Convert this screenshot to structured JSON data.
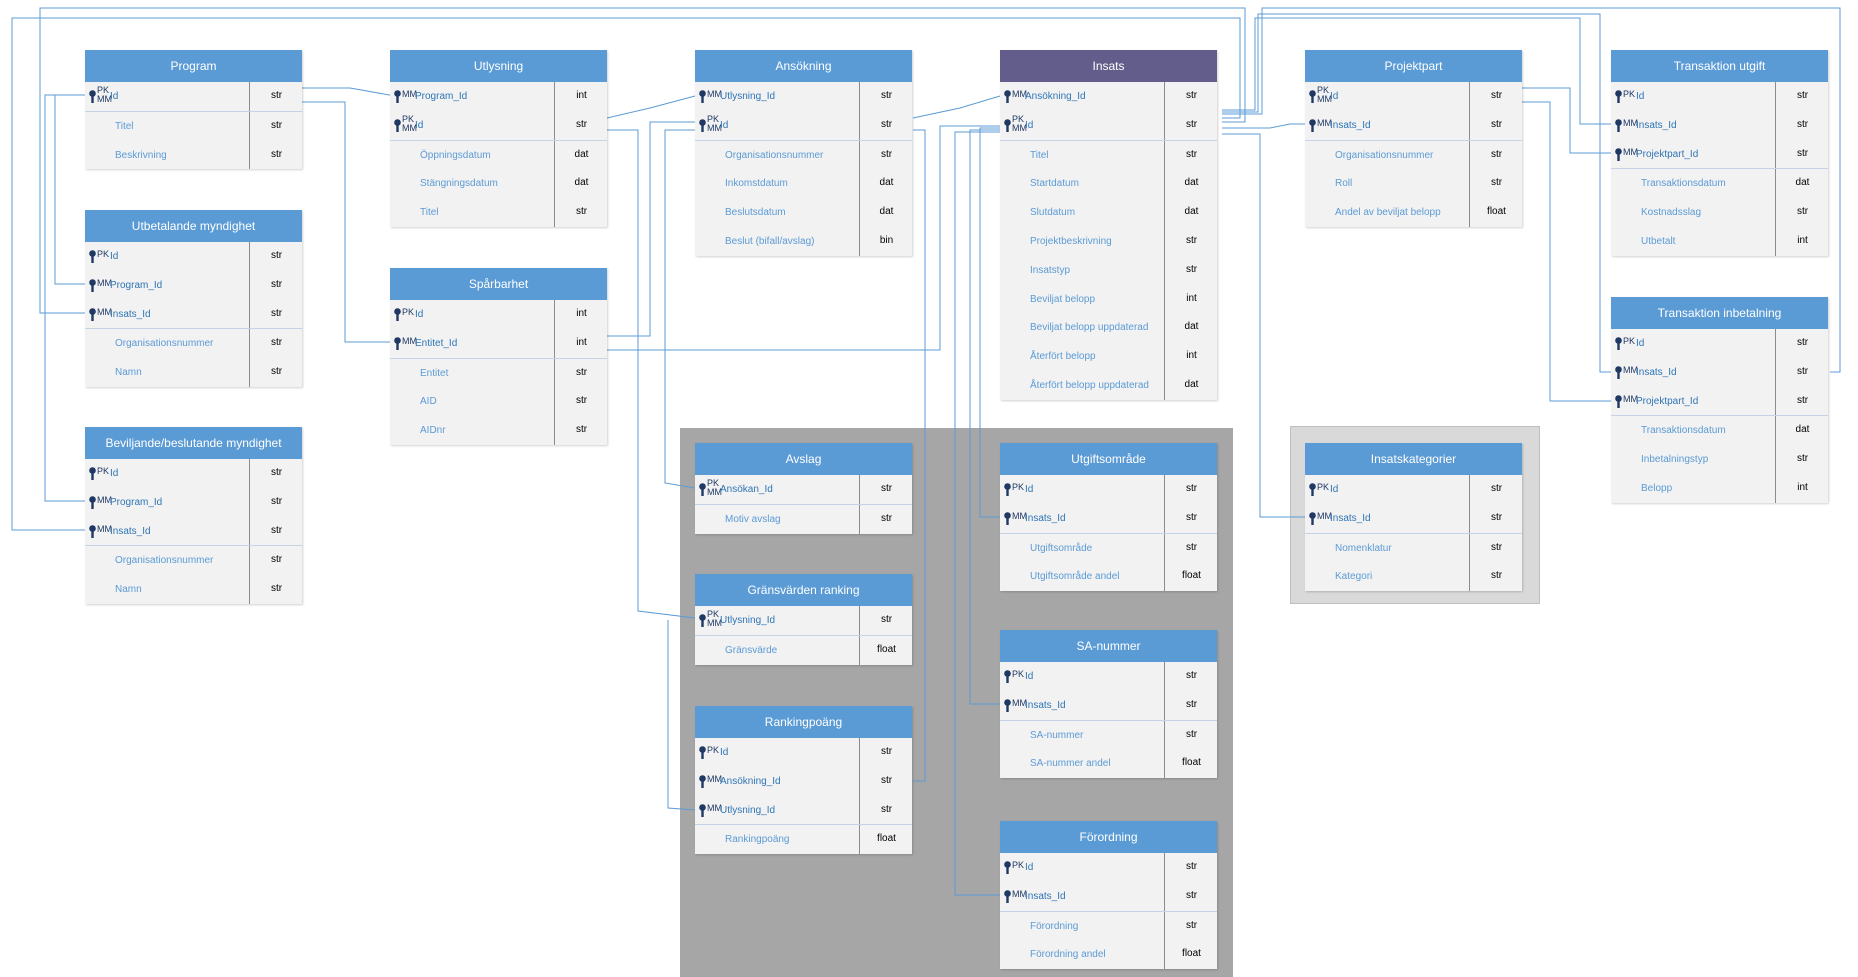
{
  "colors": {
    "header_blue": "#5b9bd5",
    "header_purple": "#635d8c",
    "connector": "#5b9bd5",
    "group_dark": "#a6a6a6",
    "group_light": "#d9d9d9"
  },
  "icons": {
    "key": "key-icon"
  },
  "entities": [
    {
      "title": "Program",
      "rows": [
        {
          "tag": "PK\nMM",
          "name": "Id",
          "type": "str",
          "key": true
        },
        {
          "tag": "",
          "name": "Titel",
          "type": "str",
          "key": false
        },
        {
          "tag": "",
          "name": "Beskrivning",
          "type": "str",
          "key": false
        }
      ]
    },
    {
      "title": "Utbetalande myndighet",
      "rows": [
        {
          "tag": "PK",
          "name": "Id",
          "type": "str",
          "key": true
        },
        {
          "tag": "MM",
          "name": "Program_Id",
          "type": "str",
          "key": true
        },
        {
          "tag": "MM",
          "name": "Insats_Id",
          "type": "str",
          "key": true
        },
        {
          "tag": "",
          "name": "Organisationsnummer",
          "type": "str",
          "key": false
        },
        {
          "tag": "",
          "name": "Namn",
          "type": "str",
          "key": false
        }
      ]
    },
    {
      "title": "Beviljande/beslutande myndighet",
      "rows": [
        {
          "tag": "PK",
          "name": "Id",
          "type": "str",
          "key": true
        },
        {
          "tag": "MM",
          "name": "Program_Id",
          "type": "str",
          "key": true
        },
        {
          "tag": "MM",
          "name": "Insats_Id",
          "type": "str",
          "key": true
        },
        {
          "tag": "",
          "name": "Organisationsnummer",
          "type": "str",
          "key": false
        },
        {
          "tag": "",
          "name": "Namn",
          "type": "str",
          "key": false
        }
      ]
    },
    {
      "title": "Utlysning",
      "rows": [
        {
          "tag": "MM",
          "name": "Program_Id",
          "type": "int",
          "key": true
        },
        {
          "tag": "PK\nMM",
          "name": "Id",
          "type": "str",
          "key": true
        },
        {
          "tag": "",
          "name": "Öppningsdatum",
          "type": "dat",
          "key": false
        },
        {
          "tag": "",
          "name": "Stängningsdatum",
          "type": "dat",
          "key": false
        },
        {
          "tag": "",
          "name": "Titel",
          "type": "str",
          "key": false
        }
      ]
    },
    {
      "title": "Spårbarhet",
      "rows": [
        {
          "tag": "PK",
          "name": "Id",
          "type": "int",
          "key": true
        },
        {
          "tag": "MM",
          "name": "Entitet_Id",
          "type": "int",
          "key": true
        },
        {
          "tag": "",
          "name": "Entitet",
          "type": "str",
          "key": false
        },
        {
          "tag": "",
          "name": "AID",
          "type": "str",
          "key": false
        },
        {
          "tag": "",
          "name": "AIDnr",
          "type": "str",
          "key": false
        }
      ]
    },
    {
      "title": "Ansökning",
      "rows": [
        {
          "tag": "MM",
          "name": "Utlysning_Id",
          "type": "str",
          "key": true
        },
        {
          "tag": "PK\nMM",
          "name": "Id",
          "type": "str",
          "key": true
        },
        {
          "tag": "",
          "name": "Organisationsnummer",
          "type": "str",
          "key": false
        },
        {
          "tag": "",
          "name": "Inkomstdatum",
          "type": "dat",
          "key": false
        },
        {
          "tag": "",
          "name": "Beslutsdatum",
          "type": "dat",
          "key": false
        },
        {
          "tag": "",
          "name": "Beslut (bifall/avslag)",
          "type": "bin",
          "key": false
        }
      ]
    },
    {
      "title": "Insats",
      "purple": true,
      "rows": [
        {
          "tag": "MM",
          "name": "Ansökning_Id",
          "type": "str",
          "key": true
        },
        {
          "tag": "PK\nMM",
          "name": "Id",
          "type": "str",
          "key": true
        },
        {
          "tag": "",
          "name": "Titel",
          "type": "str",
          "key": false
        },
        {
          "tag": "",
          "name": "Startdatum",
          "type": "dat",
          "key": false
        },
        {
          "tag": "",
          "name": "Slutdatum",
          "type": "dat",
          "key": false
        },
        {
          "tag": "",
          "name": "Projektbeskrivning",
          "type": "str",
          "key": false
        },
        {
          "tag": "",
          "name": "Insatstyp",
          "type": "str",
          "key": false
        },
        {
          "tag": "",
          "name": "Beviljat belopp",
          "type": "int",
          "key": false
        },
        {
          "tag": "",
          "name": "Beviljat belopp uppdaterad",
          "type": "dat",
          "key": false
        },
        {
          "tag": "",
          "name": "Återfört belopp",
          "type": "int",
          "key": false
        },
        {
          "tag": "",
          "name": "Återfört belopp uppdaterad",
          "type": "dat",
          "key": false
        }
      ]
    },
    {
      "title": "Projektpart",
      "rows": [
        {
          "tag": "PK\nMM",
          "name": "Id",
          "type": "str",
          "key": true
        },
        {
          "tag": "MM",
          "name": "Insats_Id",
          "type": "str",
          "key": true
        },
        {
          "tag": "",
          "name": "Organisationsnummer",
          "type": "str",
          "key": false
        },
        {
          "tag": "",
          "name": "Roll",
          "type": "str",
          "key": false
        },
        {
          "tag": "",
          "name": "Andel av beviljat belopp",
          "type": "float",
          "key": false
        }
      ]
    },
    {
      "title": "Transaktion utgift",
      "rows": [
        {
          "tag": "PK",
          "name": "Id",
          "type": "str",
          "key": true
        },
        {
          "tag": "MM",
          "name": "Insats_Id",
          "type": "str",
          "key": true
        },
        {
          "tag": "MM",
          "name": "Projektpart_Id",
          "type": "str",
          "key": true
        },
        {
          "tag": "",
          "name": "Transaktionsdatum",
          "type": "dat",
          "key": false
        },
        {
          "tag": "",
          "name": "Kostnadsslag",
          "type": "str",
          "key": false
        },
        {
          "tag": "",
          "name": "Utbetalt",
          "type": "int",
          "key": false
        }
      ]
    },
    {
      "title": "Transaktion inbetalning",
      "rows": [
        {
          "tag": "PK",
          "name": "Id",
          "type": "str",
          "key": true
        },
        {
          "tag": "MM",
          "name": "Insats_Id",
          "type": "str",
          "key": true
        },
        {
          "tag": "MM",
          "name": "Projektpart_Id",
          "type": "str",
          "key": true
        },
        {
          "tag": "",
          "name": "Transaktionsdatum",
          "type": "dat",
          "key": false
        },
        {
          "tag": "",
          "name": "Inbetalningstyp",
          "type": "str",
          "key": false
        },
        {
          "tag": "",
          "name": "Belopp",
          "type": "int",
          "key": false
        }
      ]
    },
    {
      "title": "Avslag",
      "rows": [
        {
          "tag": "PK\nMM",
          "name": "Ansökan_Id",
          "type": "str",
          "key": true
        },
        {
          "tag": "",
          "name": "Motiv avslag",
          "type": "str",
          "key": false
        }
      ]
    },
    {
      "title": "Gränsvärden ranking",
      "rows": [
        {
          "tag": "PK\nMM",
          "name": "Utlysning_Id",
          "type": "str",
          "key": true
        },
        {
          "tag": "",
          "name": "Gränsvärde",
          "type": "float",
          "key": false
        }
      ]
    },
    {
      "title": "Rankingpoäng",
      "rows": [
        {
          "tag": "PK",
          "name": "Id",
          "type": "str",
          "key": true
        },
        {
          "tag": "MM",
          "name": "Ansökning_Id",
          "type": "str",
          "key": true
        },
        {
          "tag": "MM",
          "name": "Utlysning_Id",
          "type": "str",
          "key": true
        },
        {
          "tag": "",
          "name": "Rankingpoäng",
          "type": "float",
          "key": false
        }
      ]
    },
    {
      "title": "Utgiftsområde",
      "rows": [
        {
          "tag": "PK",
          "name": "Id",
          "type": "str",
          "key": true
        },
        {
          "tag": "MM",
          "name": "Insats_Id",
          "type": "str",
          "key": true
        },
        {
          "tag": "",
          "name": "Utgiftsområde",
          "type": "str",
          "key": false
        },
        {
          "tag": "",
          "name": "Utgiftsområde andel",
          "type": "float",
          "key": false
        }
      ]
    },
    {
      "title": "SA-nummer",
      "rows": [
        {
          "tag": "PK",
          "name": "Id",
          "type": "str",
          "key": true
        },
        {
          "tag": "MM",
          "name": "Insats_Id",
          "type": "str",
          "key": true
        },
        {
          "tag": "",
          "name": "SA-nummer",
          "type": "str",
          "key": false
        },
        {
          "tag": "",
          "name": "SA-nummer andel",
          "type": "float",
          "key": false
        }
      ]
    },
    {
      "title": "Förordning",
      "rows": [
        {
          "tag": "PK",
          "name": "Id",
          "type": "str",
          "key": true
        },
        {
          "tag": "MM",
          "name": "Insats_Id",
          "type": "str",
          "key": true
        },
        {
          "tag": "",
          "name": "Förordning",
          "type": "str",
          "key": false
        },
        {
          "tag": "",
          "name": "Förordning andel",
          "type": "float",
          "key": false
        }
      ]
    },
    {
      "title": "Insatskategorier",
      "rows": [
        {
          "tag": "PK",
          "name": "Id",
          "type": "str",
          "key": true
        },
        {
          "tag": "MM",
          "name": "Insats_Id",
          "type": "str",
          "key": true
        },
        {
          "tag": "",
          "name": "Nomenklatur",
          "type": "str",
          "key": false
        },
        {
          "tag": "",
          "name": "Kategori",
          "type": "str",
          "key": false
        }
      ]
    }
  ]
}
